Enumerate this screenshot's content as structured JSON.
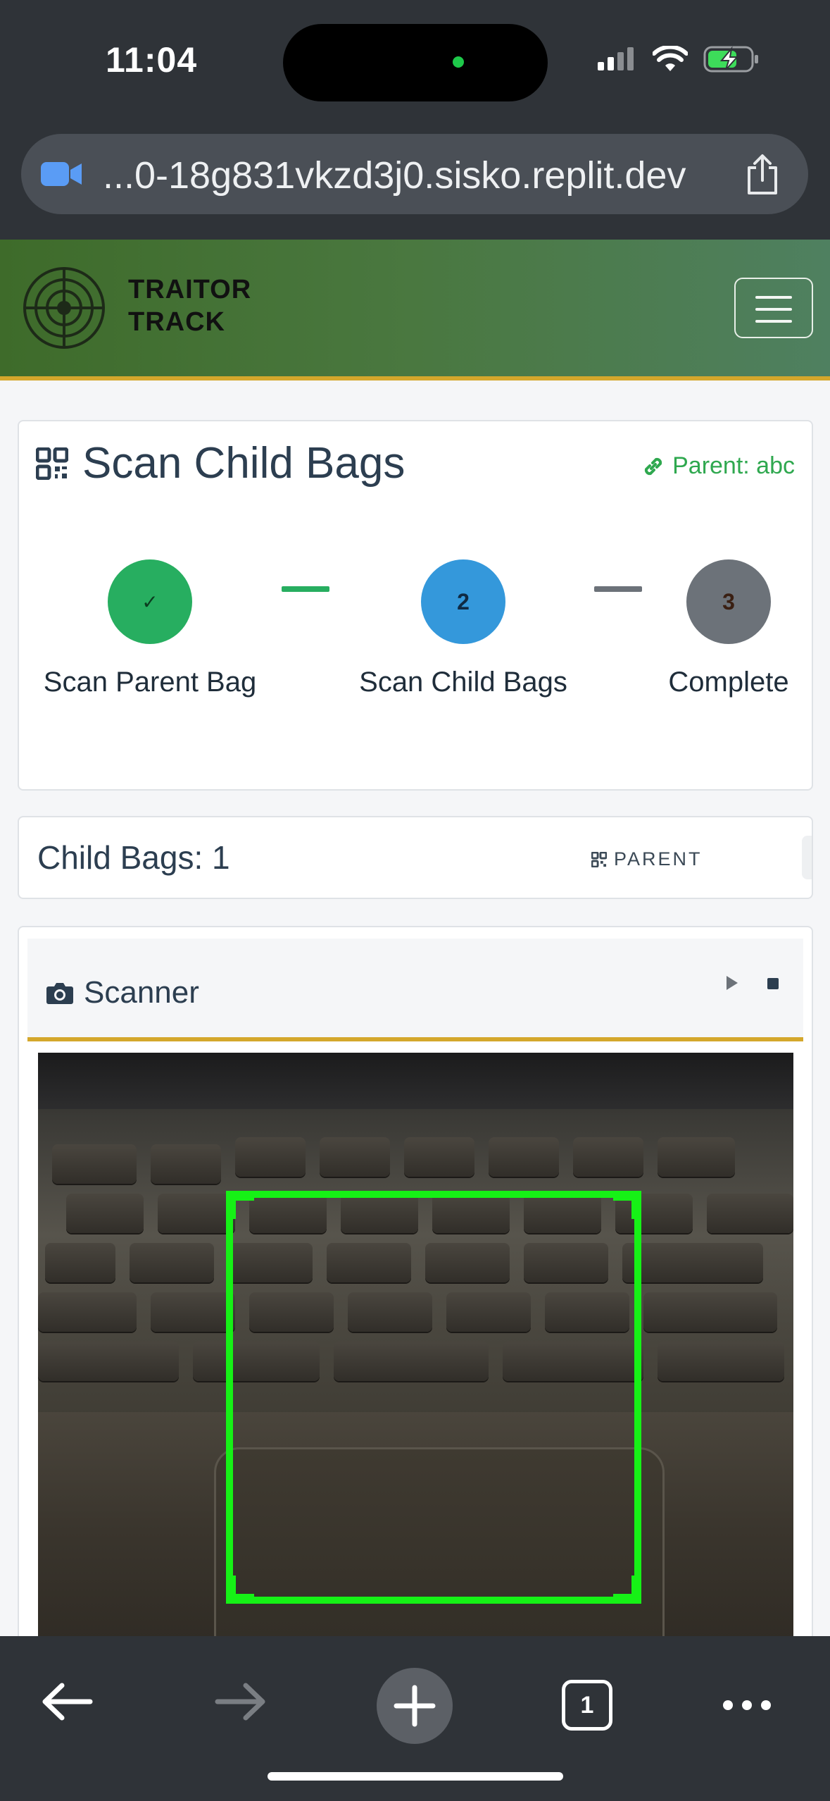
{
  "status_bar": {
    "time": "11:04"
  },
  "browser": {
    "url": "...0-18g831vkzd3j0.sisko.replit.dev",
    "tab_count": "1"
  },
  "app": {
    "brand_line1": "TRAITOR",
    "brand_line2": "TRACK"
  },
  "page": {
    "title": "Scan Child Bags",
    "parent_link": "Parent: abc"
  },
  "steps": [
    {
      "marker": "✓",
      "label": "Scan Parent Bag",
      "state": "done",
      "color": "#27ae60"
    },
    {
      "marker": "2",
      "label": "Scan Child Bags",
      "state": "active",
      "color": "#3498db"
    },
    {
      "marker": "3",
      "label": "Complete",
      "state": "pending",
      "color": "#6c7279"
    }
  ],
  "counter": {
    "text": "Child Bags: 1",
    "parent_button": "PARENT"
  },
  "scanner": {
    "title": "Scanner"
  },
  "colors": {
    "accent_gold": "#d4a72c",
    "scan_frame": "#16f116",
    "header_green": "#3e6b2a"
  }
}
